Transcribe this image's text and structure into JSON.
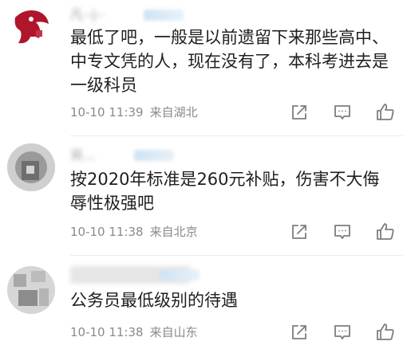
{
  "comments": [
    {
      "username": "凡·-|-·",
      "text": "最低了吧，一般是以前遗留下来那些高中、中专文凭的人，现在没有了，本科考进去是一级科员",
      "time": "10-10 11:39",
      "location": "来自湖北",
      "avatar_color": "#b0152b"
    },
    {
      "username": "另...",
      "text": "按2020年标准是260元补贴，伤害不大侮辱性极强吧",
      "time": "10-10 11:38",
      "location": "来自北京",
      "avatar_color": "#8d8d8d"
    },
    {
      "username": "· ·",
      "text": "公务员最低级别的待遇",
      "time": "10-10 11:38",
      "location": "来自山东",
      "avatar_color": "#9c9c9c"
    }
  ],
  "icons": {
    "share": "share-icon",
    "reply": "reply-icon",
    "like": "thumbs-up-icon"
  },
  "colors": {
    "text": "#1f1f1f",
    "meta": "#8a8a8a",
    "icon": "#7d7d7d"
  }
}
